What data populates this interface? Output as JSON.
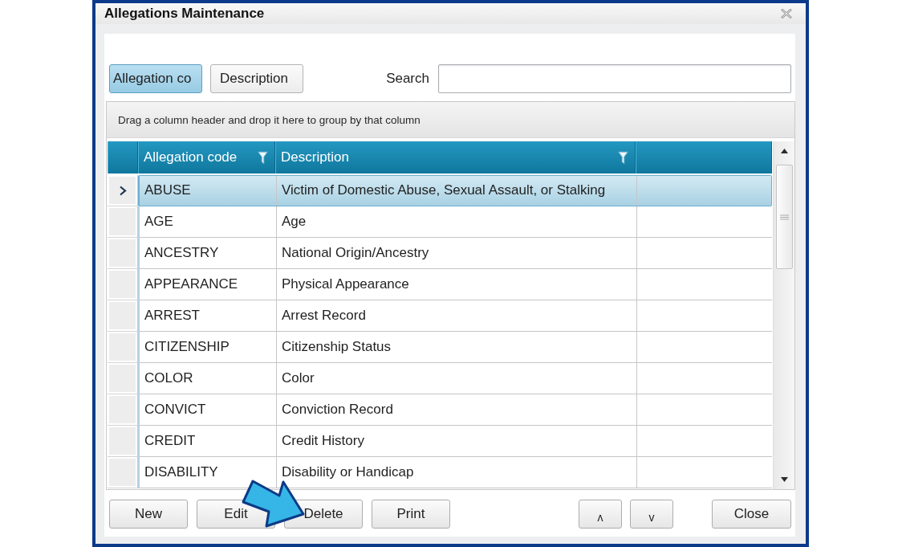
{
  "window": {
    "title": "Allegations Maintenance"
  },
  "search_by": [
    {
      "label": "Allegation co",
      "selected": true
    },
    {
      "label": "Description",
      "selected": false
    }
  ],
  "search": {
    "label": "Search"
  },
  "grid": {
    "group_panel_hint": "Drag a column header and drop it here to group by that column",
    "columns": [
      {
        "label": "Allegation code",
        "filter": true
      },
      {
        "label": "Description",
        "filter": true
      }
    ],
    "rows": [
      {
        "code": "ABUSE",
        "description": "Victim of Domestic Abuse, Sexual Assault, or Stalking",
        "selected": true
      },
      {
        "code": "AGE",
        "description": "Age",
        "selected": false
      },
      {
        "code": "ANCESTRY",
        "description": "National Origin/Ancestry",
        "selected": false
      },
      {
        "code": "APPEARANCE",
        "description": "Physical Appearance",
        "selected": false
      },
      {
        "code": "ARREST",
        "description": "Arrest Record",
        "selected": false
      },
      {
        "code": "CITIZENSHIP",
        "description": "Citizenship Status",
        "selected": false
      },
      {
        "code": "COLOR",
        "description": "Color",
        "selected": false
      },
      {
        "code": "CONVICT",
        "description": "Conviction Record",
        "selected": false
      },
      {
        "code": "CREDIT",
        "description": "Credit History",
        "selected": false
      },
      {
        "code": "DISABILITY",
        "description": "Disability or Handicap",
        "selected": false
      }
    ]
  },
  "buttons": {
    "actions": [
      "New",
      "Edit",
      "Delete",
      "Print"
    ],
    "reorder": [
      "ʌ",
      "v"
    ],
    "close": "Close"
  },
  "annotations": [
    {
      "kind": "arrow"
    }
  ]
}
